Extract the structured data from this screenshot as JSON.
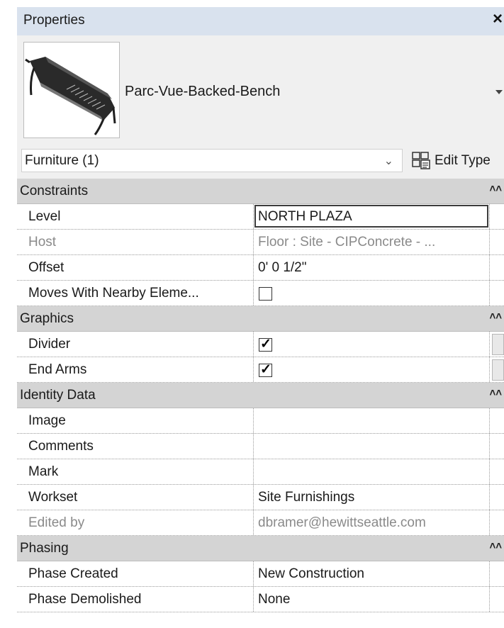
{
  "header": {
    "title": "Properties",
    "close_label": "×"
  },
  "type_selector": {
    "name": "Parc-Vue-Backed-Bench"
  },
  "filter": {
    "value": "Furniture (1)",
    "edit_type_label": "Edit Type"
  },
  "categories": {
    "constraints": "Constraints",
    "graphics": "Graphics",
    "identity": "Identity Data",
    "phasing": "Phasing"
  },
  "params": {
    "level": {
      "name": "Level",
      "value": "NORTH PLAZA"
    },
    "host": {
      "name": "Host",
      "value": "Floor : Site - CIPConcrete - ..."
    },
    "offset": {
      "name": "Offset",
      "value": "0'  0 1/2\""
    },
    "moves": {
      "name": "Moves With Nearby Eleme...",
      "checked": false
    },
    "divider": {
      "name": "Divider",
      "checked": true
    },
    "end_arms": {
      "name": "End Arms",
      "checked": true
    },
    "image": {
      "name": "Image",
      "value": ""
    },
    "comments": {
      "name": "Comments",
      "value": ""
    },
    "mark": {
      "name": "Mark",
      "value": ""
    },
    "workset": {
      "name": "Workset",
      "value": "Site Furnishings"
    },
    "edited_by": {
      "name": "Edited by",
      "value": "dbramer@hewittseattle.com"
    },
    "phase_created": {
      "name": "Phase Created",
      "value": "New Construction"
    },
    "phase_demolished": {
      "name": "Phase Demolished",
      "value": "None"
    }
  },
  "icons": {
    "close": "close-icon",
    "type_dropdown": "chevron-down-icon",
    "filter_dropdown": "chevron-down-icon",
    "edit_type": "edit-type-icon",
    "collapse": "collapse-icon",
    "checkbox": "checkmark-icon"
  },
  "colors": {
    "title_bar": "#d9e2ee",
    "category_bg": "#d4d4d4",
    "panel_bg": "#f0f0f0",
    "readonly_text": "#8a8a8a"
  }
}
